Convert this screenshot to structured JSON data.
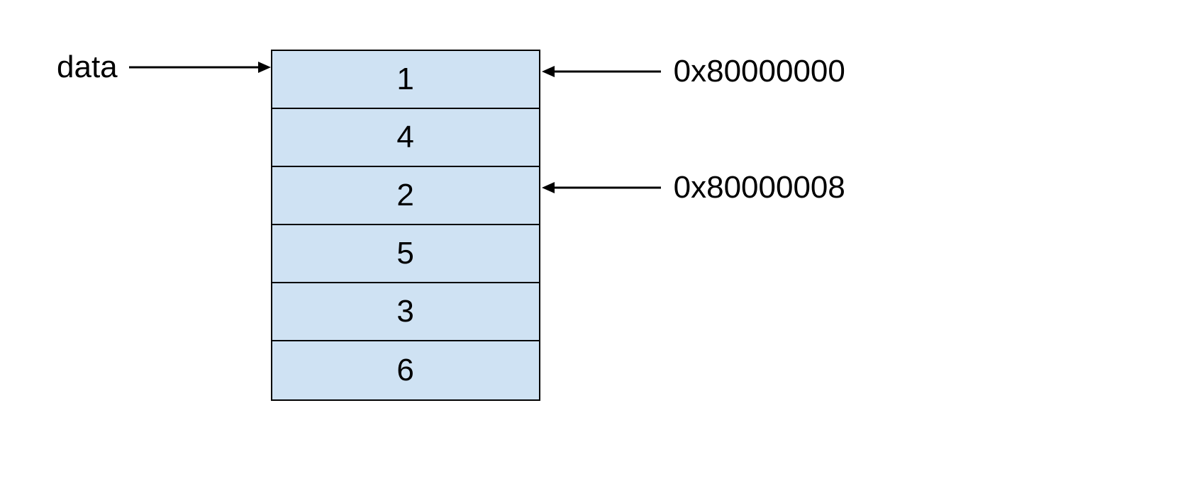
{
  "left_label": "data",
  "cells": {
    "c0": "1",
    "c1": "4",
    "c2": "2",
    "c3": "5",
    "c4": "3",
    "c5": "6"
  },
  "addresses": {
    "a0": "0x80000000",
    "a1": "0x80000008"
  }
}
